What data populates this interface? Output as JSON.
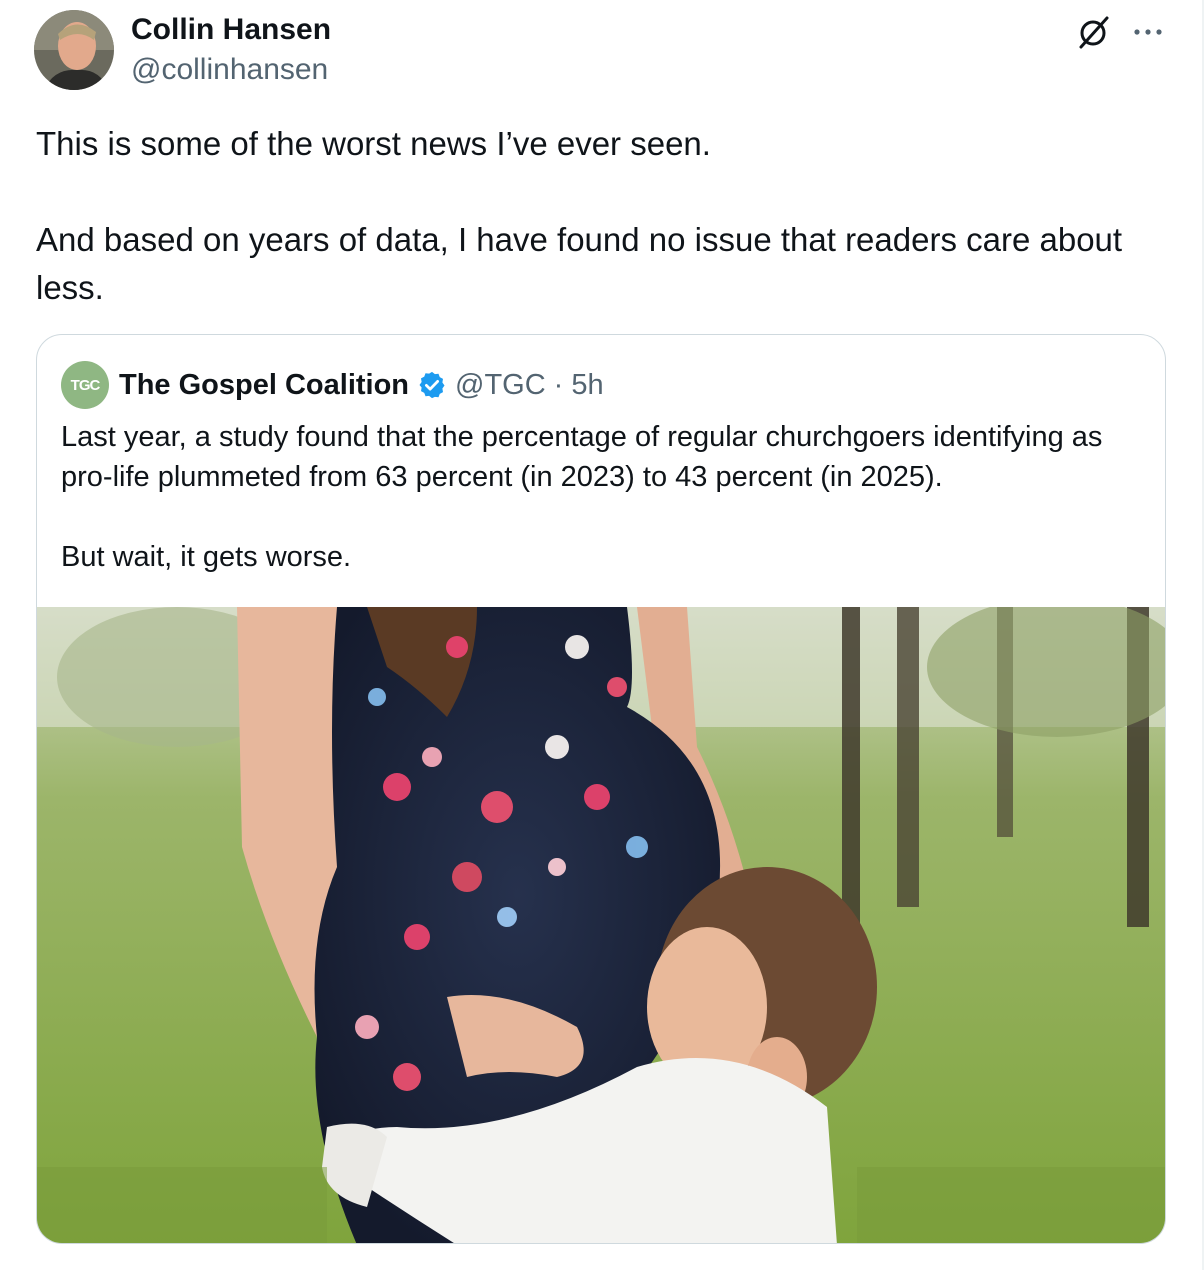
{
  "author": {
    "name": "Collin Hansen",
    "handle": "@collinhansen"
  },
  "tweet": {
    "paragraphs": [
      "This is some of the worst news I’ve ever seen.",
      "And based on years of data, I have found no issue that readers care about less."
    ]
  },
  "quoted": {
    "avatar_text": "TGC",
    "name": "The Gospel Coalition",
    "handle": "@TGC",
    "separator": "·",
    "time": "5h",
    "paragraphs": [
      "Last year, a study found that the percentage of regular churchgoers identifying as pro-life plummeted from 63 percent (in 2023) to 43 percent (in 2025).",
      "But wait, it gets worse."
    ]
  },
  "icons": {
    "grok": "grok-icon",
    "more": "more-icon",
    "verified": "verified-badge-icon"
  },
  "colors": {
    "text": "#0f1419",
    "secondary": "#536471",
    "border": "#cfd9de",
    "verified": "#1d9bf0",
    "tgc_green": "#8fb783"
  }
}
